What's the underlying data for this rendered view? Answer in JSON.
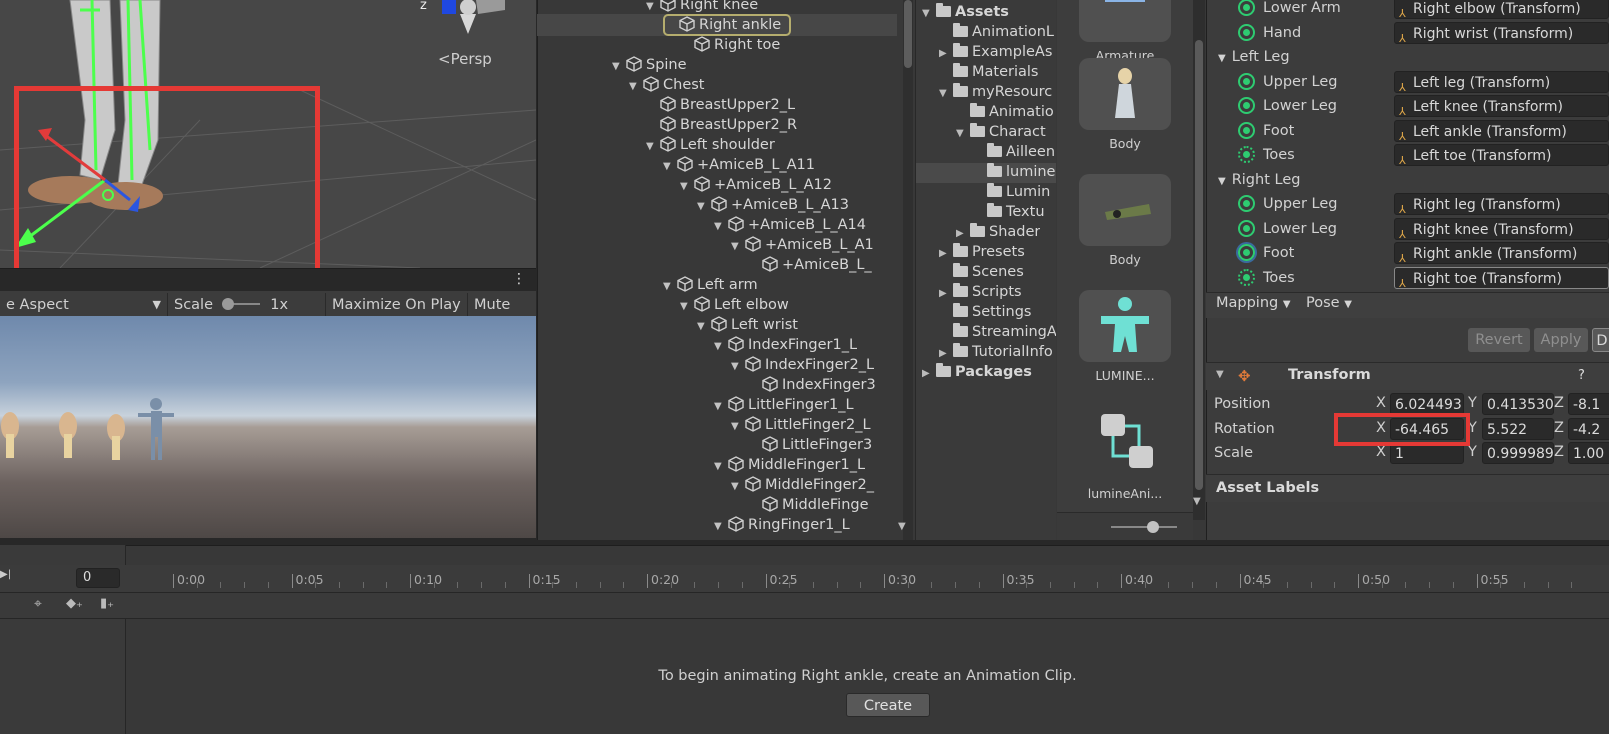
{
  "scene": {
    "camera_label": "Persp",
    "axis_label": "z"
  },
  "game_toolbar": {
    "aspect": "e Aspect",
    "scale_label": "Scale",
    "scale_value": "1x",
    "maximize": "Maximize On Play",
    "mute": "Mute Aud"
  },
  "hierarchy": {
    "items": [
      {
        "label": "Right knee",
        "depth": 7,
        "arrow": "▼"
      },
      {
        "label": "Right ankle",
        "depth": 8,
        "arrow": "",
        "selected": true
      },
      {
        "label": "Right toe",
        "depth": 9,
        "arrow": ""
      },
      {
        "label": "Spine",
        "depth": 5,
        "arrow": "▼"
      },
      {
        "label": "Chest",
        "depth": 6,
        "arrow": "▼"
      },
      {
        "label": "BreastUpper2_L",
        "depth": 7,
        "arrow": ""
      },
      {
        "label": "BreastUpper2_R",
        "depth": 7,
        "arrow": ""
      },
      {
        "label": "Left shoulder",
        "depth": 7,
        "arrow": "▼"
      },
      {
        "label": "+AmiceB_L_A11",
        "depth": 8,
        "arrow": "▼"
      },
      {
        "label": "+AmiceB_L_A12",
        "depth": 9,
        "arrow": "▼"
      },
      {
        "label": "+AmiceB_L_A13",
        "depth": 10,
        "arrow": "▼"
      },
      {
        "label": "+AmiceB_L_A14",
        "depth": 11,
        "arrow": "▼"
      },
      {
        "label": "+AmiceB_L_A1",
        "depth": 12,
        "arrow": "▼"
      },
      {
        "label": "+AmiceB_L_",
        "depth": 13,
        "arrow": ""
      },
      {
        "label": "Left arm",
        "depth": 8,
        "arrow": "▼"
      },
      {
        "label": "Left elbow",
        "depth": 9,
        "arrow": "▼"
      },
      {
        "label": "Left wrist",
        "depth": 10,
        "arrow": "▼"
      },
      {
        "label": "IndexFinger1_L",
        "depth": 11,
        "arrow": "▼"
      },
      {
        "label": "IndexFinger2_L",
        "depth": 12,
        "arrow": "▼"
      },
      {
        "label": "IndexFinger3",
        "depth": 13,
        "arrow": ""
      },
      {
        "label": "LittleFinger1_L",
        "depth": 11,
        "arrow": "▼"
      },
      {
        "label": "LittleFinger2_L",
        "depth": 12,
        "arrow": "▼"
      },
      {
        "label": "LittleFinger3",
        "depth": 13,
        "arrow": ""
      },
      {
        "label": "MiddleFinger1_L",
        "depth": 11,
        "arrow": "▼"
      },
      {
        "label": "MiddleFinger2_",
        "depth": 12,
        "arrow": "▼"
      },
      {
        "label": "MiddleFinge",
        "depth": 13,
        "arrow": ""
      },
      {
        "label": "RingFinger1_L",
        "depth": 11,
        "arrow": "▼"
      }
    ]
  },
  "project": {
    "tree": [
      {
        "label": "Assets",
        "depth": 0,
        "arrow": "▼",
        "bold": true
      },
      {
        "label": "AnimationL",
        "depth": 1,
        "arrow": ""
      },
      {
        "label": "ExampleAs",
        "depth": 1,
        "arrow": "▶"
      },
      {
        "label": "Materials",
        "depth": 1,
        "arrow": ""
      },
      {
        "label": "myResourc",
        "depth": 1,
        "arrow": "▼"
      },
      {
        "label": "Animatio",
        "depth": 2,
        "arrow": ""
      },
      {
        "label": "Charact",
        "depth": 2,
        "arrow": "▼"
      },
      {
        "label": "Ailleen",
        "depth": 3,
        "arrow": ""
      },
      {
        "label": "lumine",
        "depth": 3,
        "arrow": "",
        "selected": true
      },
      {
        "label": "Lumin",
        "depth": 3,
        "arrow": ""
      },
      {
        "label": "Textu",
        "depth": 3,
        "arrow": ""
      },
      {
        "label": "Shader",
        "depth": 2,
        "arrow": "▶"
      },
      {
        "label": "Presets",
        "depth": 1,
        "arrow": "▶"
      },
      {
        "label": "Scenes",
        "depth": 1,
        "arrow": ""
      },
      {
        "label": "Scripts",
        "depth": 1,
        "arrow": "▶"
      },
      {
        "label": "Settings",
        "depth": 1,
        "arrow": ""
      },
      {
        "label": "StreamingA",
        "depth": 1,
        "arrow": ""
      },
      {
        "label": "TutorialInfo",
        "depth": 1,
        "arrow": "▶"
      },
      {
        "label": "Packages",
        "depth": 0,
        "arrow": "▶",
        "bold": true
      }
    ],
    "tiles": [
      "Armature",
      "Body",
      "Body",
      "LUMINE...",
      "lumineAni..."
    ]
  },
  "inspector": {
    "arm_rows": [
      {
        "label": "Lower Arm",
        "value": "Right elbow (Transform)"
      },
      {
        "label": "Hand",
        "value": "Right wrist (Transform)"
      }
    ],
    "left_leg_header": "Left Leg",
    "left_leg": [
      {
        "label": "Upper Leg",
        "value": "Left leg (Transform)"
      },
      {
        "label": "Lower Leg",
        "value": "Left knee (Transform)"
      },
      {
        "label": "Foot",
        "value": "Left ankle (Transform)"
      },
      {
        "label": "Toes",
        "value": "Left toe (Transform)"
      }
    ],
    "right_leg_header": "Right Leg",
    "right_leg": [
      {
        "label": "Upper Leg",
        "value": "Right leg (Transform)"
      },
      {
        "label": "Lower Leg",
        "value": "Right knee (Transform)"
      },
      {
        "label": "Foot",
        "value": "Right ankle (Transform)"
      },
      {
        "label": "Toes",
        "value": "Right toe (Transform)"
      }
    ],
    "mapping": "Mapping",
    "pose": "Pose",
    "revert": "Revert",
    "apply": "Apply",
    "done": "D",
    "transform_title": "Transform",
    "position_label": "Position",
    "rotation_label": "Rotation",
    "scale_label": "Scale",
    "x": "X",
    "y": "Y",
    "z": "Z",
    "position": {
      "x": "6.024493",
      "y": "0.413530",
      "z": "-8.1"
    },
    "rotation": {
      "x": "-64.465",
      "y": "5.522",
      "z": "-4.2"
    },
    "scale": {
      "x": "1",
      "y": "0.999989",
      "z": "1.00"
    },
    "asset_labels": "Asset Labels"
  },
  "animation": {
    "frame": "0",
    "ticks": [
      "0:00",
      "0:05",
      "0:10",
      "0:15",
      "0:20",
      "0:25",
      "0:30",
      "0:35",
      "0:40",
      "0:45",
      "0:50",
      "0:55"
    ],
    "message": "To begin animating Right ankle, create an Animation Clip.",
    "create": "Create"
  },
  "colors": {
    "highlight_red": "#e53935",
    "bone_green": "#2ecc71",
    "selection_outline": "#b5ad6e"
  }
}
